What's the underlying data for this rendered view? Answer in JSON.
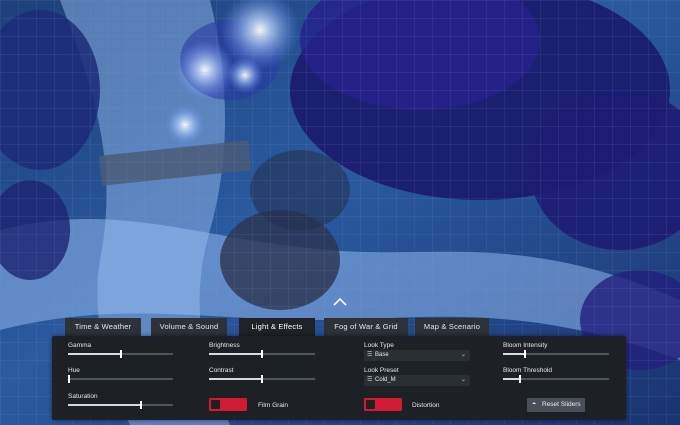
{
  "tabs": [
    {
      "label": "Time & Weather",
      "active": false
    },
    {
      "label": "Volume & Sound",
      "active": false
    },
    {
      "label": "Light & Effects",
      "active": true
    },
    {
      "label": "Fog of War & Grid",
      "active": false
    },
    {
      "label": "Map & Scenario",
      "active": false
    }
  ],
  "sliders": {
    "gamma": {
      "label": "Gamma",
      "value": 0.5
    },
    "hue": {
      "label": "Hue",
      "value": 0.0
    },
    "saturation": {
      "label": "Saturation",
      "value": 0.7
    },
    "brightness": {
      "label": "Brightness",
      "value": 0.5
    },
    "contrast": {
      "label": "Contrast",
      "value": 0.5
    },
    "bloom_intensity": {
      "label": "Bloom Intensity",
      "value": 0.2
    },
    "bloom_threshold": {
      "label": "Bloom Threshold",
      "value": 0.15
    }
  },
  "look_type": {
    "label": "Look Type",
    "value": "Base"
  },
  "look_preset": {
    "label": "Look Preset",
    "value": "Cold_M"
  },
  "film_grain": {
    "label": "Film Grain",
    "enabled": false
  },
  "distortion": {
    "label": "Distortion",
    "enabled": false
  },
  "reset_button": {
    "label": "Reset Sliders"
  },
  "colors": {
    "accent_toggle": "#d11a33",
    "panel": "#1d2024",
    "tab": "#2d3138"
  }
}
